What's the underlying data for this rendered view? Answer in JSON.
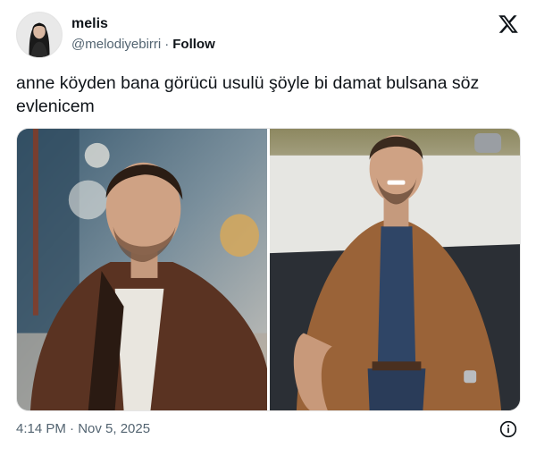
{
  "author": {
    "name": "melis",
    "handle": "@melodiyebirri",
    "separator": "·",
    "follow_label": "Follow"
  },
  "tweet": {
    "text": "anne köyden bana görücü usulü şöyle bi damat bulsana söz evlenicem",
    "timestamp": "4:14 PM · Nov 5, 2025"
  },
  "icons": {
    "brand": "x-logo-icon",
    "info": "info-icon"
  },
  "colors": {
    "text_primary": "#0f1419",
    "text_secondary": "#536471"
  }
}
